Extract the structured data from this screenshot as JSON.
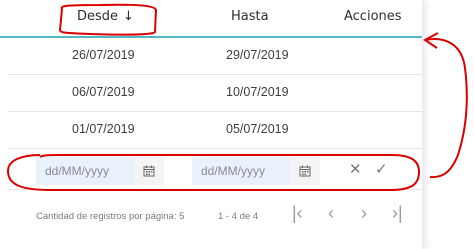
{
  "table": {
    "headers": {
      "desde": "Desde",
      "hasta": "Hasta",
      "acciones": "Acciones"
    },
    "sort_indicator": "↓",
    "rows": [
      {
        "desde": "26/07/2019",
        "hasta": "29/07/2019"
      },
      {
        "desde": "06/07/2019",
        "hasta": "10/07/2019"
      },
      {
        "desde": "01/07/2019",
        "hasta": "05/07/2019"
      }
    ],
    "filter": {
      "desde_placeholder": "dd/MM/yyyy",
      "hasta_placeholder": "dd/MM/yyyy",
      "cancel_icon": "✕",
      "confirm_icon": "✓"
    }
  },
  "pagination": {
    "page_size_label": "Cantidad de registros por página: 5",
    "range_label": "1 - 4 de 4",
    "first_icon": "|‹",
    "prev_icon": "‹",
    "next_icon": "›",
    "last_icon": "›|"
  },
  "annotation_color": "#d80000",
  "accent_color": "#53b7c9"
}
